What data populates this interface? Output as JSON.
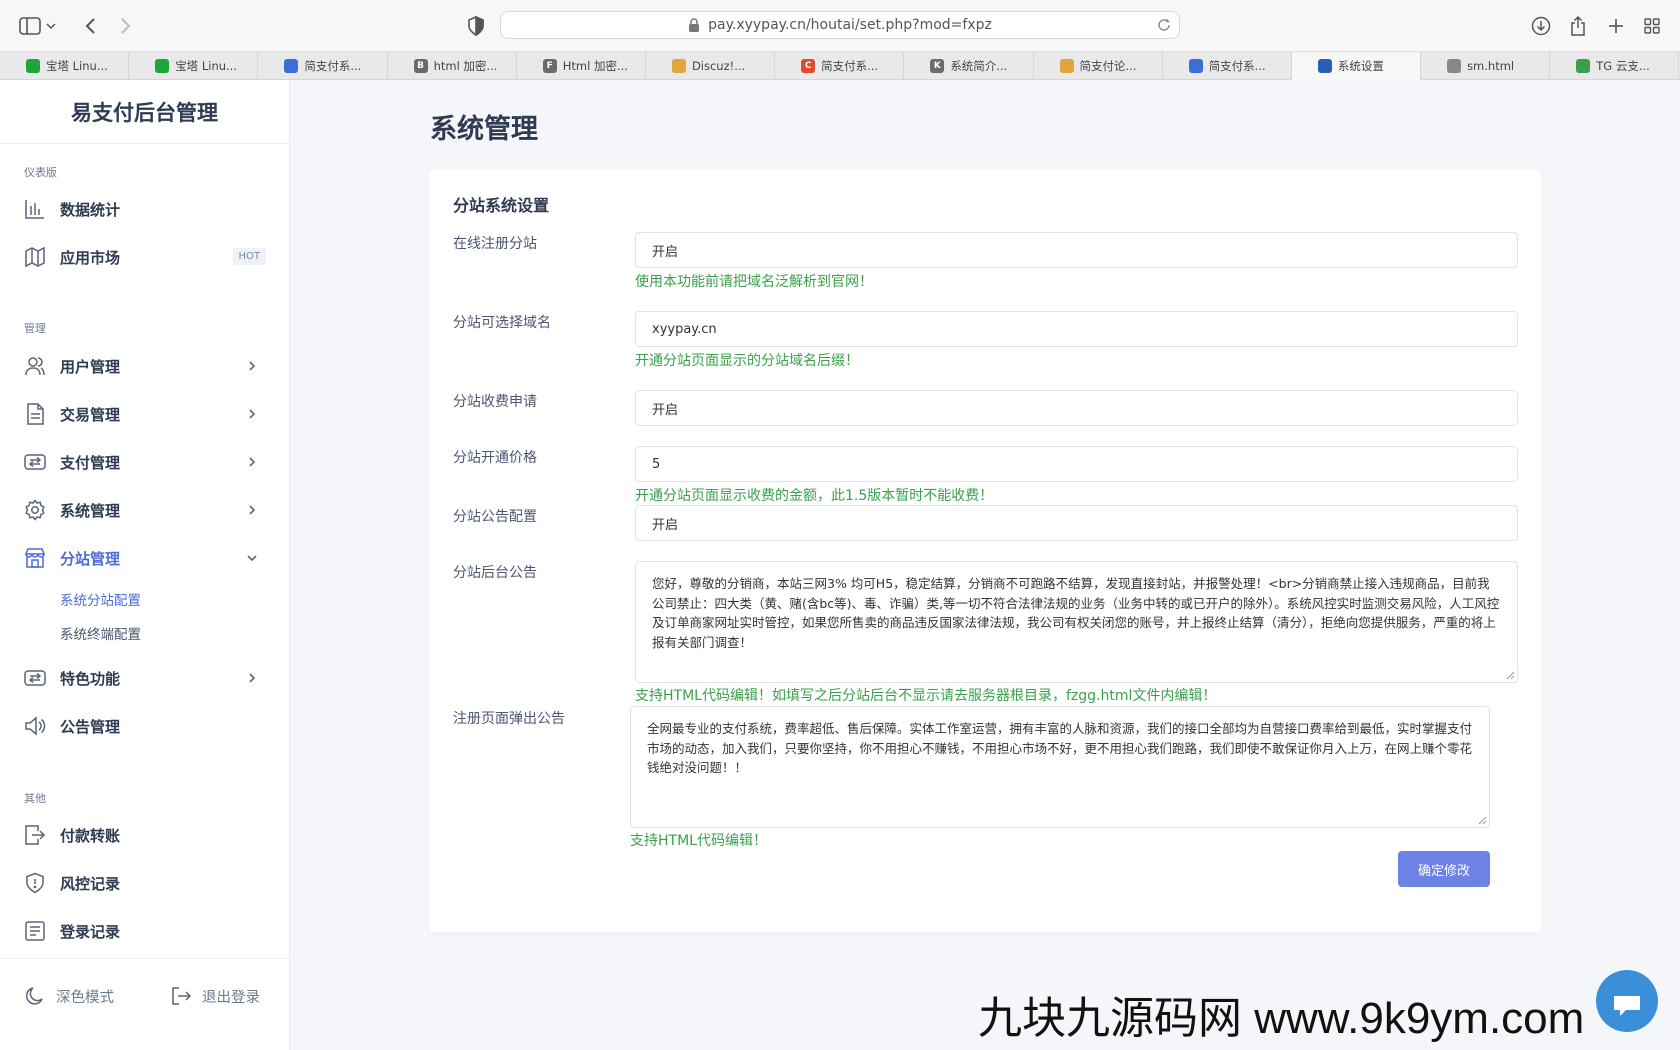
{
  "browser": {
    "url": "pay.xyypay.cn/houtai/set.php?mod=fxpz",
    "tabs": [
      {
        "label": "宝塔 Linu...",
        "color": "#20a53a",
        "glyph": ""
      },
      {
        "label": "宝塔 Linu...",
        "color": "#20a53a",
        "glyph": ""
      },
      {
        "label": "简支付系...",
        "color": "#3b6fd6",
        "glyph": ""
      },
      {
        "label": "html 加密...",
        "color": "#6b6b6b",
        "glyph": "B"
      },
      {
        "label": "Html 加密...",
        "color": "#6b6b6b",
        "glyph": "F"
      },
      {
        "label": "Discuz!...",
        "color": "#e0a63a",
        "glyph": ""
      },
      {
        "label": "简支付系...",
        "color": "#e24b2a",
        "glyph": "C"
      },
      {
        "label": "系统简介...",
        "color": "#6b6b6b",
        "glyph": "K"
      },
      {
        "label": "简支付论...",
        "color": "#e0a63a",
        "glyph": ""
      },
      {
        "label": "简支付系...",
        "color": "#3b6fd6",
        "glyph": ""
      },
      {
        "label": "系统设置",
        "color": "#2a5fb8",
        "glyph": "",
        "active": true
      },
      {
        "label": "sm.html",
        "color": "#888888",
        "glyph": ""
      },
      {
        "label": "TG 云支...",
        "color": "#3aa04b",
        "glyph": ""
      }
    ]
  },
  "sidebar": {
    "brand": "易支付后台管理",
    "sections": {
      "dashboard": "仪表版",
      "manage": "管理",
      "other": "其他"
    },
    "items": {
      "stats": "数据统计",
      "market": "应用市场",
      "market_badge": "HOT",
      "users": "用户管理",
      "trade": "交易管理",
      "pay": "支付管理",
      "system": "系统管理",
      "substation": "分站管理",
      "sub_config": "系统分站配置",
      "sub_terminal": "系统终端配置",
      "feature": "特色功能",
      "notice": "公告管理",
      "transfer": "付款转账",
      "risk": "风控记录",
      "login": "登录记录"
    },
    "footer": {
      "dark": "深色模式",
      "logout": "退出登录"
    }
  },
  "main": {
    "title": "系统管理",
    "card_title": "分站系统设置",
    "fields": {
      "online_reg": {
        "label": "在线注册分站",
        "value": "开启",
        "hint": "使用本功能前请把域名泛解析到官网！"
      },
      "domain": {
        "label": "分站可选择域名",
        "value": "xyypay.cn",
        "hint": "开通分站页面显示的分站域名后缀！"
      },
      "fee_apply": {
        "label": "分站收费申请",
        "value": "开启"
      },
      "price": {
        "label": "分站开通价格",
        "value": "5",
        "hint": "开通分站页面显示收费的金额，此1.5版本暂时不能收费！"
      },
      "notice_cfg": {
        "label": "分站公告配置",
        "value": "开启"
      },
      "admin_notice": {
        "label": "分站后台公告",
        "value": "您好，尊敬的分销商，本站三网3% 均可H5，稳定结算，分销商不可跑路不结算，发现直接封站，并报警处理！<br>分销商禁止接入违规商品，目前我公司禁止：四大类（黄、赌(含bc等)、毒、诈骗）类,等一切不符合法律法规的业务（业务中转的或已开户的除外）。系统风控实时监测交易风险，人工风控及订单商家网址实时管控，如果您所售卖的商品违反国家法律法规，我公司有权关闭您的账号，并上报终止结算（清分），拒绝向您提供服务，严重的将上报有关部门调查！",
        "hint": "支持HTML代码编辑！如填写之后分站后台不显示请去服务器根目录，fzgg.html文件内编辑！"
      },
      "reg_popup": {
        "label": "注册页面弹出公告",
        "value": "全网最专业的支付系统，费率超低、售后保障。实体工作室运营，拥有丰富的人脉和资源，我们的接口全部均为自营接口费率给到最低，实时掌握支付市场的动态，加入我们，只要你坚持，你不用担心不赚钱，不用担心市场不好，更不用担心我们跑路，我们即使不敢保证你月入上万，在网上赚个零花钱绝对没问题！！",
        "hint": "支持HTML代码编辑！"
      }
    },
    "submit": "确定修改"
  },
  "watermark": "九块九源码网 www.9k9ym.com",
  "colors": {
    "accent": "#4e6bd6",
    "hint": "#3aa04b",
    "button": "#6c82e4"
  }
}
